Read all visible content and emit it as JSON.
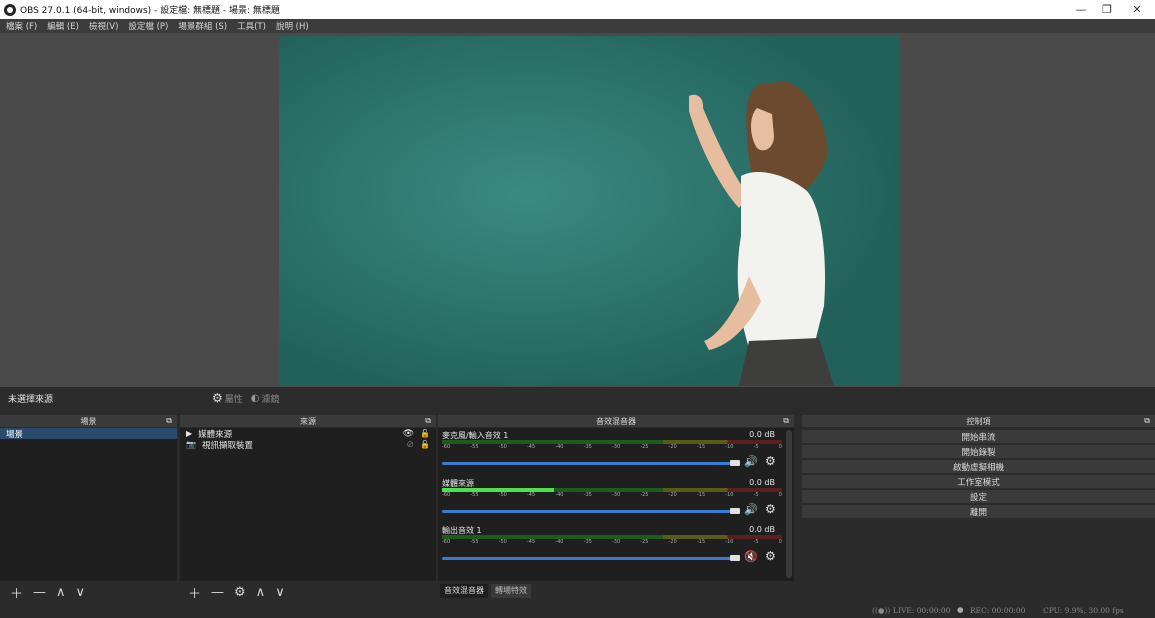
{
  "window": {
    "title": "OBS 27.0.1 (64-bit, windows) - 設定檔: 無標題 - 場景: 無標題",
    "minimize": "—",
    "restore": "❐",
    "close": "✕"
  },
  "menu": [
    "檔案 (F)",
    "編輯 (E)",
    "檢視(V)",
    "設定檔 (P)",
    "場景群組 (S)",
    "工具(T)",
    "說明 (H)"
  ],
  "source_toolbar": {
    "none_selected": "未選擇來源",
    "properties": "屬性",
    "filters": "濾鏡"
  },
  "docks": {
    "scenes": {
      "title": "場景",
      "items": [
        "場景"
      ]
    },
    "sources": {
      "title": "來源",
      "items": [
        {
          "icon": "play-icon",
          "label": "媒體來源"
        },
        {
          "icon": "camera-icon",
          "label": "視訊擷取裝置"
        }
      ]
    },
    "mixer": {
      "title": "音效混音器",
      "channels": [
        {
          "name": "麥克風/輸入音效 1",
          "db": "0.0 dB",
          "muted": false,
          "level": 0
        },
        {
          "name": "媒體來源",
          "db": "0.0 dB",
          "muted": false,
          "level": 0.33
        },
        {
          "name": "輸出音效 1",
          "db": "0.0 dB",
          "muted": true,
          "level": 0
        }
      ],
      "ticks": [
        "-60",
        "-55",
        "-50",
        "-45",
        "-40",
        "-35",
        "-30",
        "-25",
        "-20",
        "-15",
        "-10",
        "-5",
        "0"
      ]
    },
    "controls": {
      "title": "控制項",
      "buttons": [
        "開始串流",
        "開始錄製",
        "啟動虛擬相機",
        "工作室模式",
        "設定",
        "離開"
      ]
    }
  },
  "mixer_tabs": [
    "音效混音器",
    "轉場特效"
  ],
  "status": {
    "live": "LIVE: 00:00:00",
    "rec": "REC: 00:00:00",
    "cpu": "CPU: 9.9%, 30.00 fps"
  },
  "colors": {
    "accent": "#3b7bd4",
    "muted": "#d42020",
    "chalkboard": "#2a6f67"
  }
}
